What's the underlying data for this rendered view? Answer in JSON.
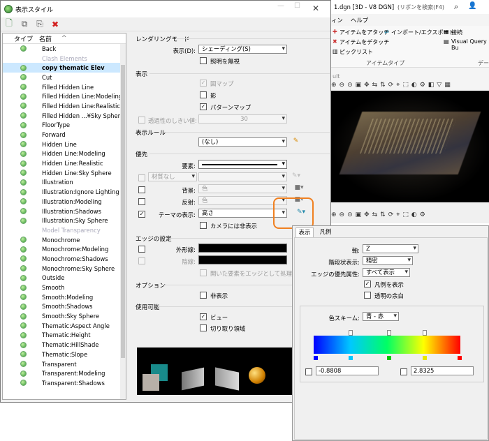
{
  "dialog": {
    "title": "表示スタイル",
    "toolbar": {
      "new_icon": "new-style-icon",
      "copy_icon": "copy-style-icon",
      "import_icon": "import-style-icon",
      "delete_icon": "delete-icon"
    },
    "list": {
      "col_type": "タイプ",
      "col_name": "名前",
      "sort_indicator": "^",
      "items": [
        {
          "name": "Back",
          "header": false
        },
        {
          "name": "Clash Elements",
          "header": true
        },
        {
          "name": "copy thematic Elev",
          "header": false,
          "selected": true
        },
        {
          "name": "Cut",
          "header": false
        },
        {
          "name": "Filled Hidden Line",
          "header": false
        },
        {
          "name": "Filled Hidden Line:Modeling",
          "header": false
        },
        {
          "name": "Filled Hidden Line:Realistic",
          "header": false
        },
        {
          "name": "Filled Hidden ...¥Sky Sphere",
          "header": false
        },
        {
          "name": "FloorType",
          "header": false
        },
        {
          "name": "Forward",
          "header": false
        },
        {
          "name": "Hidden Line",
          "header": false
        },
        {
          "name": "Hidden Line:Modeling",
          "header": false
        },
        {
          "name": "Hidden Line:Realistic",
          "header": false
        },
        {
          "name": "Hidden Line:Sky Sphere",
          "header": false
        },
        {
          "name": "Illustration",
          "header": false
        },
        {
          "name": "Illustration:Ignore Lighting",
          "header": false
        },
        {
          "name": "Illustration:Modeling",
          "header": false
        },
        {
          "name": "Illustration:Shadows",
          "header": false
        },
        {
          "name": "Illustration:Sky Sphere",
          "header": false
        },
        {
          "name": "Model Transparency",
          "header": true
        },
        {
          "name": "Monochrome",
          "header": false
        },
        {
          "name": "Monochrome:Modeling",
          "header": false
        },
        {
          "name": "Monochrome:Shadows",
          "header": false
        },
        {
          "name": "Monochrome:Sky Sphere",
          "header": false
        },
        {
          "name": "Outside",
          "header": false
        },
        {
          "name": "Smooth",
          "header": false
        },
        {
          "name": "Smooth:Modeling",
          "header": false
        },
        {
          "name": "Smooth:Shadows",
          "header": false
        },
        {
          "name": "Smooth:Sky Sphere",
          "header": false
        },
        {
          "name": "Thematic:Aspect Angle",
          "header": false
        },
        {
          "name": "Thematic:Height",
          "header": false
        },
        {
          "name": "Thematic:HillShade",
          "header": false
        },
        {
          "name": "Thematic:Slope",
          "header": false
        },
        {
          "name": "Transparent",
          "header": false
        },
        {
          "name": "Transparent:Modeling",
          "header": false
        },
        {
          "name": "Transparent:Shadows",
          "header": false
        }
      ]
    },
    "props": {
      "rendering_mode": "レンダリングモード",
      "display_label": "表示(D):",
      "display_value": "シェーディング(S)",
      "lighting_disable": "照明を無視",
      "display_section": "表示",
      "map": "図マップ",
      "shadow": "影",
      "pattern_map": "パターンマップ",
      "transparency_threshold": "透過性のしきい値:",
      "transparency_value": "30",
      "display_rule": "表示ルール",
      "display_rule_value": "(なし)",
      "priority": "優先",
      "element": "要素:",
      "material": "材質なし",
      "background": "背景:",
      "background_value": "色",
      "reflection": "反射:",
      "reflection_value": "色",
      "theme_display": "テーマの表示:",
      "theme_value": "高さ",
      "camera_hide": "カメラには非表示",
      "edge_settings": "エッジの設定",
      "outline": "外形線:",
      "hidden_line": "陰線:",
      "open_element_edge": "開いた要素をエッジとして処理",
      "options": "オプション",
      "hidden": "非表示",
      "usable": "使用可能",
      "view": "ビュー",
      "clip_region": "切り取り領域"
    }
  },
  "background_app": {
    "title": "1.dgn [3D - V8 DGN]",
    "search_hint": "(リボンを検索(F4)",
    "menu_help": "ヘルプ",
    "menu_view": "ィン",
    "attach_item": "アイテムをアタッチ",
    "detach_item": "アイテムをデタッチ",
    "pick_list": "ピックリスト",
    "import_export": "インポート/エクスポート",
    "connect": "接続",
    "visual_query": "Visual Query Bu",
    "item_type": "アイテムタイプ",
    "data_label": "デー",
    "view_label": "ult"
  },
  "thematic_panel": {
    "tab_display": "表示",
    "tab_legend": "凡例",
    "axis_label": "軸:",
    "axis_value": "Z",
    "stepped_label": "階段状表示:",
    "stepped_value": "精密",
    "edge_priority_label": "エッジの優先属性:",
    "edge_priority_value": "すべて表示",
    "show_legend": "凡例を表示",
    "transparent_margin": "透明の余白",
    "color_scheme_label": "色スキーム:",
    "color_scheme_value": "青 - 赤",
    "min_value": "-0.8808",
    "max_value": "2.8325"
  },
  "colors": {
    "accent_orange": "#f08020",
    "selection": "#cce8ff"
  }
}
